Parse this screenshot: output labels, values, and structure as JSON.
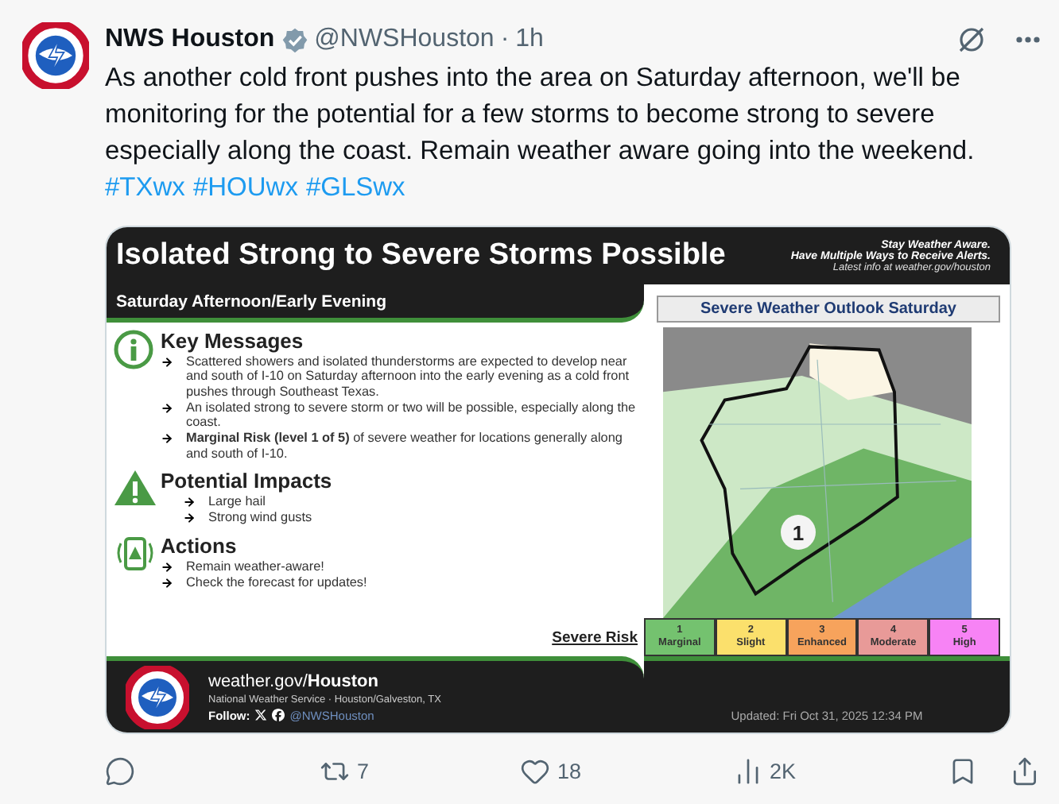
{
  "tweet": {
    "author": {
      "name": "NWS Houston",
      "handle": "@NWSHouston",
      "separator": "·",
      "time": "1h"
    },
    "text": "As another cold front pushes into the area on Saturday afternoon, we'll be monitoring for the potential for a few storms to become strong to severe especially along the coast. Remain weather aware going into the weekend.",
    "hashtags": [
      "#TXwx",
      "#HOUwx",
      "#GLSwx"
    ],
    "graphic": {
      "title": "Isolated Strong to Severe Storms Possible",
      "subtitle": "Saturday Afternoon/Early Evening",
      "header_notes": [
        {
          "kind": "emphasis",
          "text": "Stay Weather Aware."
        },
        {
          "kind": "emphasis",
          "text": "Have Multiple Ways to Receive Alerts."
        },
        {
          "kind": "note",
          "text": "Latest info at weather.gov/houston"
        }
      ],
      "sections": [
        {
          "kind": "info",
          "heading": "Key Messages",
          "bullets": [
            "Scattered showers and isolated thunderstorms are expected to develop near and south of I-10 on Saturday afternoon into the early evening as a cold front pushes through Southeast Texas.",
            "An isolated strong to severe storm or two will be possible, especially along the coast.",
            "**Marginal Risk (level 1 of 5)** of severe weather for locations generally along and south of I-10."
          ]
        },
        {
          "kind": "warning",
          "heading": "Potential Impacts",
          "bullets": [
            "Large hail",
            "Strong wind gusts"
          ]
        },
        {
          "kind": "phone",
          "heading": "Actions",
          "bullets": [
            "Remain weather-aware!",
            "Check the forecast for updates!"
          ]
        }
      ],
      "map": {
        "title": "Severe Weather Outlook Saturday",
        "risk_label": "1"
      },
      "legend": {
        "label": "Severe Risk",
        "levels": [
          {
            "number": "1",
            "name": "Marginal",
            "color": "#74c26f"
          },
          {
            "number": "2",
            "name": "Slight",
            "color": "#fbe06c"
          },
          {
            "number": "3",
            "name": "Enhanced",
            "color": "#f7a35c"
          },
          {
            "number": "4",
            "name": "Moderate",
            "color": "#e89a98"
          },
          {
            "number": "5",
            "name": "High",
            "color": "#f783f5"
          }
        ]
      },
      "footer": {
        "site": "weather.gov/**Houston**",
        "office": "National Weather Service · Houston/Galveston, TX",
        "follow": "Follow:",
        "handle": "@NWSHouston",
        "updated": "Updated: Fri Oct 31, 2025 12:34 PM"
      }
    },
    "actions": [
      {
        "kind": "reply"
      },
      {
        "kind": "repost",
        "count": "7"
      },
      {
        "kind": "like",
        "count": "18"
      },
      {
        "kind": "views",
        "count": "2K"
      },
      {
        "kind": "bookmark"
      },
      {
        "kind": "share"
      }
    ]
  }
}
